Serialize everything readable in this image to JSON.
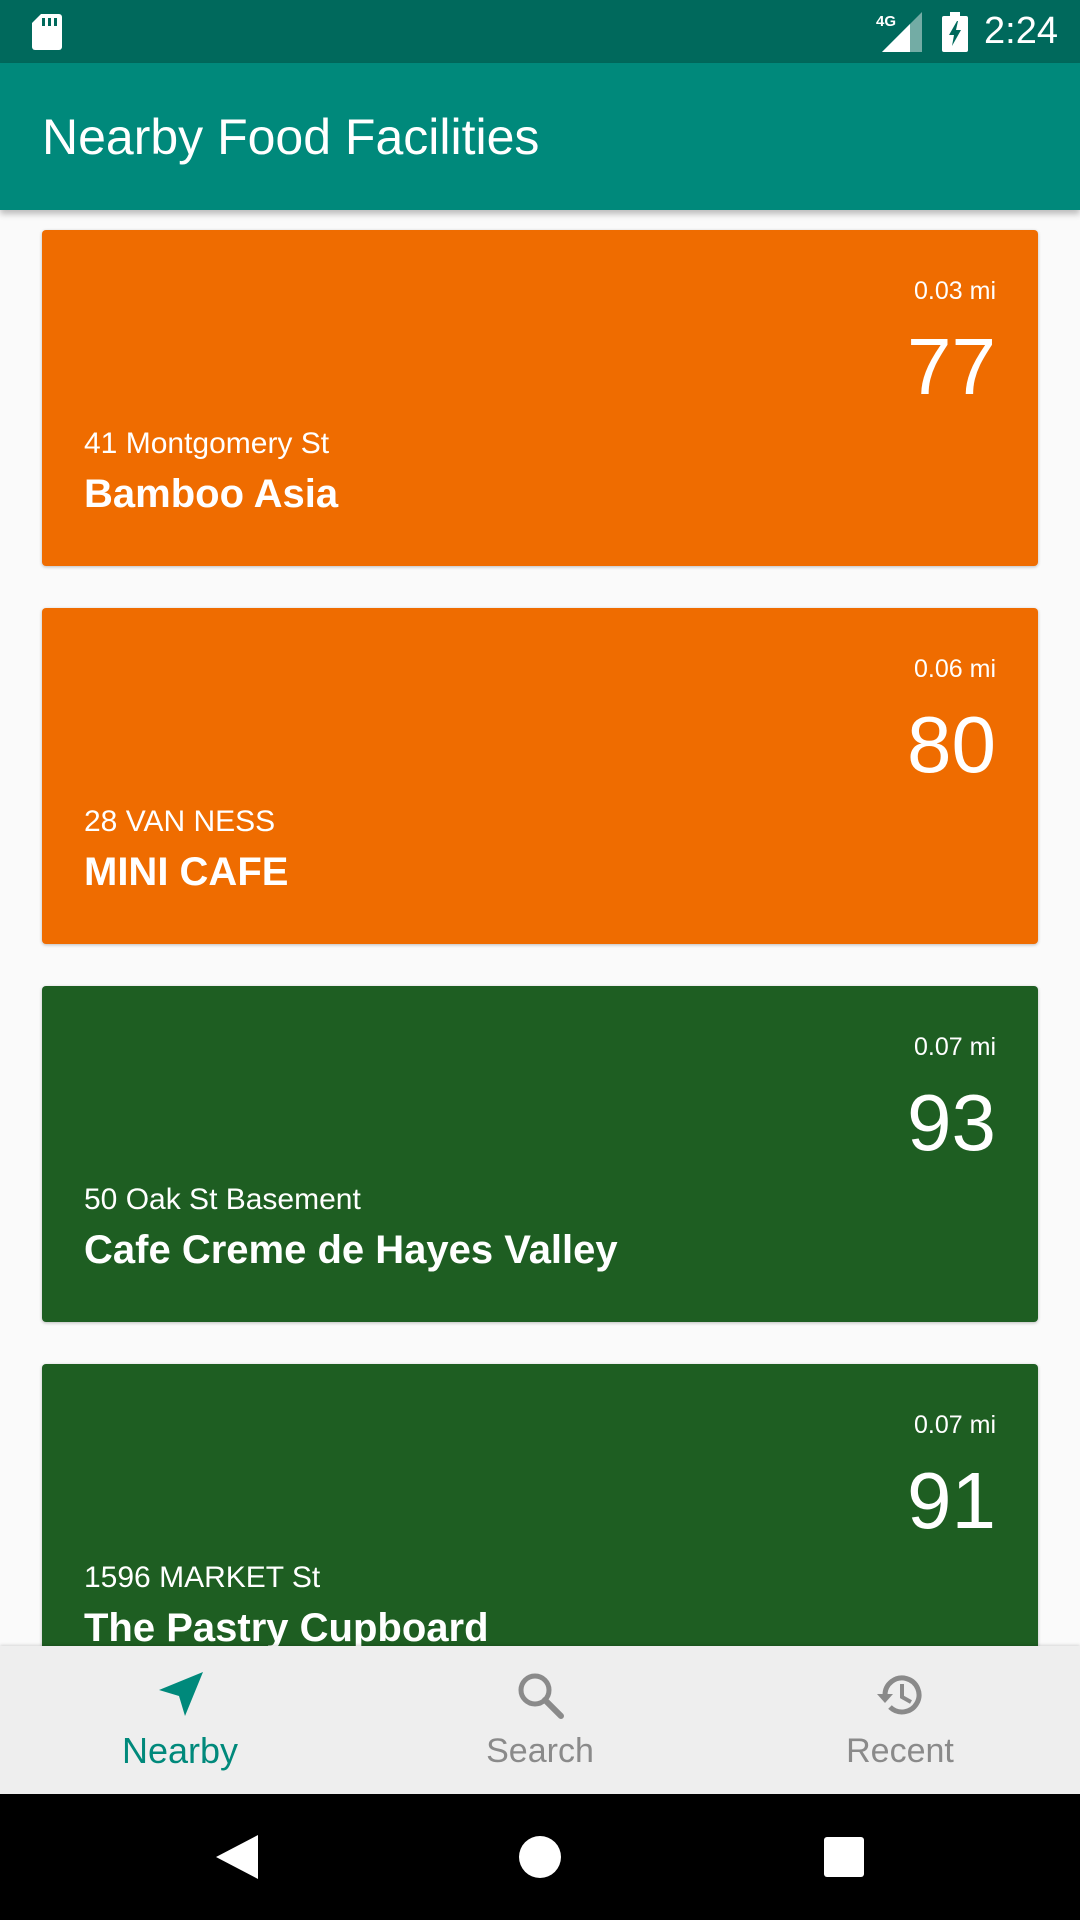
{
  "status_bar": {
    "network": "4G",
    "time": "2:24"
  },
  "app_bar": {
    "title": "Nearby Food Facilities"
  },
  "colors": {
    "status_bar": "#00695c",
    "app_bar": "#00897b",
    "accent": "#00897b",
    "card_orange": "#ef6c00",
    "card_green": "#1e5e22",
    "inactive_nav": "#8a8a8a"
  },
  "facilities": [
    {
      "distance": "0.03 mi",
      "score": "77",
      "address": "41 Montgomery St",
      "name": "Bamboo Asia",
      "color": "#ef6c00"
    },
    {
      "distance": "0.06 mi",
      "score": "80",
      "address": "28 VAN NESS",
      "name": "MINI CAFE",
      "color": "#ef6c00"
    },
    {
      "distance": "0.07 mi",
      "score": "93",
      "address": "50 Oak St  Basement",
      "name": "Cafe Creme de Hayes Valley",
      "color": "#1e5e22"
    },
    {
      "distance": "0.07 mi",
      "score": "91",
      "address": "1596 MARKET St",
      "name": "The Pastry Cupboard",
      "color": "#1e5e22"
    }
  ],
  "bottom_nav": {
    "items": [
      {
        "label": "Nearby",
        "icon": "navigation-arrow-icon",
        "active": true
      },
      {
        "label": "Search",
        "icon": "search-icon",
        "active": false
      },
      {
        "label": "Recent",
        "icon": "history-icon",
        "active": false
      }
    ]
  },
  "system_nav": {
    "back": "back-icon",
    "home": "home-icon",
    "recents": "recents-icon"
  }
}
